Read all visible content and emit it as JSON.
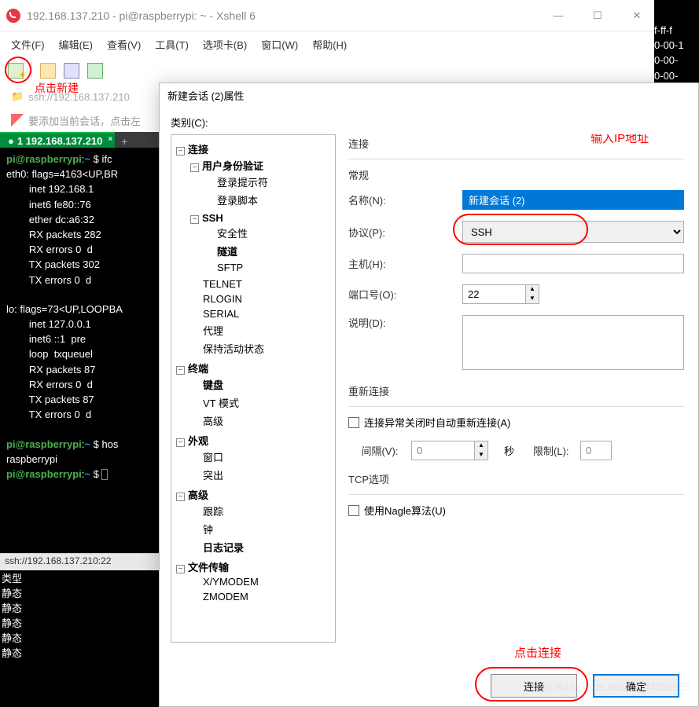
{
  "window": {
    "title": "192.168.137.210 - pi@raspberrypi: ~ - Xshell 6",
    "min": "—",
    "max": "☐",
    "close": "✕"
  },
  "menu": {
    "file": "文件(F)",
    "edit": "编辑(E)",
    "view": "查看(V)",
    "tools": "工具(T)",
    "tabs": "选项卡(B)",
    "window": "窗口(W)",
    "help": "帮助(H)"
  },
  "annotations": {
    "new": "点击新建",
    "ip": "输入IP地址",
    "connect": "点击连接"
  },
  "session": {
    "addr": "ssh://192.168.137.210",
    "tip": "要添加当前会话，点击左"
  },
  "tab": {
    "label": "1 192.168.137.210",
    "close": "×"
  },
  "terminal": {
    "l1a": "pi@raspberrypi",
    "l1b": ":",
    "l1c": "~",
    "l1d": " $ ",
    "l1cmd": "ifc",
    "l2": "eth0: flags=4163<UP,BR",
    "l3": "        inet 192.168.1",
    "l4": "        inet6 fe80::76",
    "l5": "        ether dc:a6:32",
    "l6": "        RX packets 282",
    "l7": "        RX errors 0  d",
    "l8": "        TX packets 302",
    "l9": "        TX errors 0  d",
    "l10": "",
    "l11": "lo: flags=73<UP,LOOPBA",
    "l12": "        inet 127.0.0.1",
    "l13": "        inet6 ::1  pre",
    "l14": "        loop  txqueuel",
    "l15": "        RX packets 87 ",
    "l16": "        RX errors 0  d",
    "l17": "        TX packets 87 ",
    "l18": "        TX errors 0  d",
    "l19": "",
    "l20cmd": "hos",
    "l21": "raspberrypi"
  },
  "status": "ssh://192.168.137.210:22",
  "bottom": {
    "r1": "类型",
    "r2": "静态",
    "r3": "静态",
    "r4": "静态",
    "r5": "静态",
    "r6": "静态"
  },
  "right_panel": {
    "r1": "f-ff-f",
    "r2": "0-00-1",
    "r3": "0-00-",
    "r4": "0-00-"
  },
  "dialog": {
    "title": "新建会话 (2)属性",
    "category": "类别(C):",
    "tree": {
      "connection": "连接",
      "auth": "用户身份验证",
      "login_prompt": "登录提示符",
      "login_script": "登录脚本",
      "ssh": "SSH",
      "security": "安全性",
      "tunnel": "隧道",
      "sftp": "SFTP",
      "telnet": "TELNET",
      "rlogin": "RLOGIN",
      "serial": "SERIAL",
      "proxy": "代理",
      "keepalive": "保持活动状态",
      "terminal": "终端",
      "keyboard": "键盘",
      "vt": "VT 模式",
      "advanced_t": "高级",
      "appearance": "外观",
      "window": "窗口",
      "highlight": "突出",
      "advanced": "高级",
      "trace": "跟踪",
      "bell": "钟",
      "log": "日志记录",
      "transfer": "文件传输",
      "xymodem": "X/YMODEM",
      "zmodem": "ZMODEM"
    },
    "form": {
      "section": "连接",
      "general": "常规",
      "name_label": "名称(N):",
      "name_value": "新建会话 (2)",
      "proto_label": "协议(P):",
      "proto_value": "SSH",
      "host_label": "主机(H):",
      "host_value": "",
      "port_label": "端口号(O):",
      "port_value": "22",
      "desc_label": "说明(D):",
      "desc_value": "",
      "reconnect": "重新连接",
      "reconnect_chk": "连接异常关闭时自动重新连接(A)",
      "interval_label": "间隔(V):",
      "interval_value": "0",
      "sec": "秒",
      "limit_label": "限制(L):",
      "limit_value": "0",
      "tcp": "TCP选项",
      "nagle": "使用Nagle算法(U)"
    },
    "buttons": {
      "connect": "连接",
      "ok": "确定"
    }
  },
  "watermark": "https://blog.csdn.net/m0_47035555"
}
